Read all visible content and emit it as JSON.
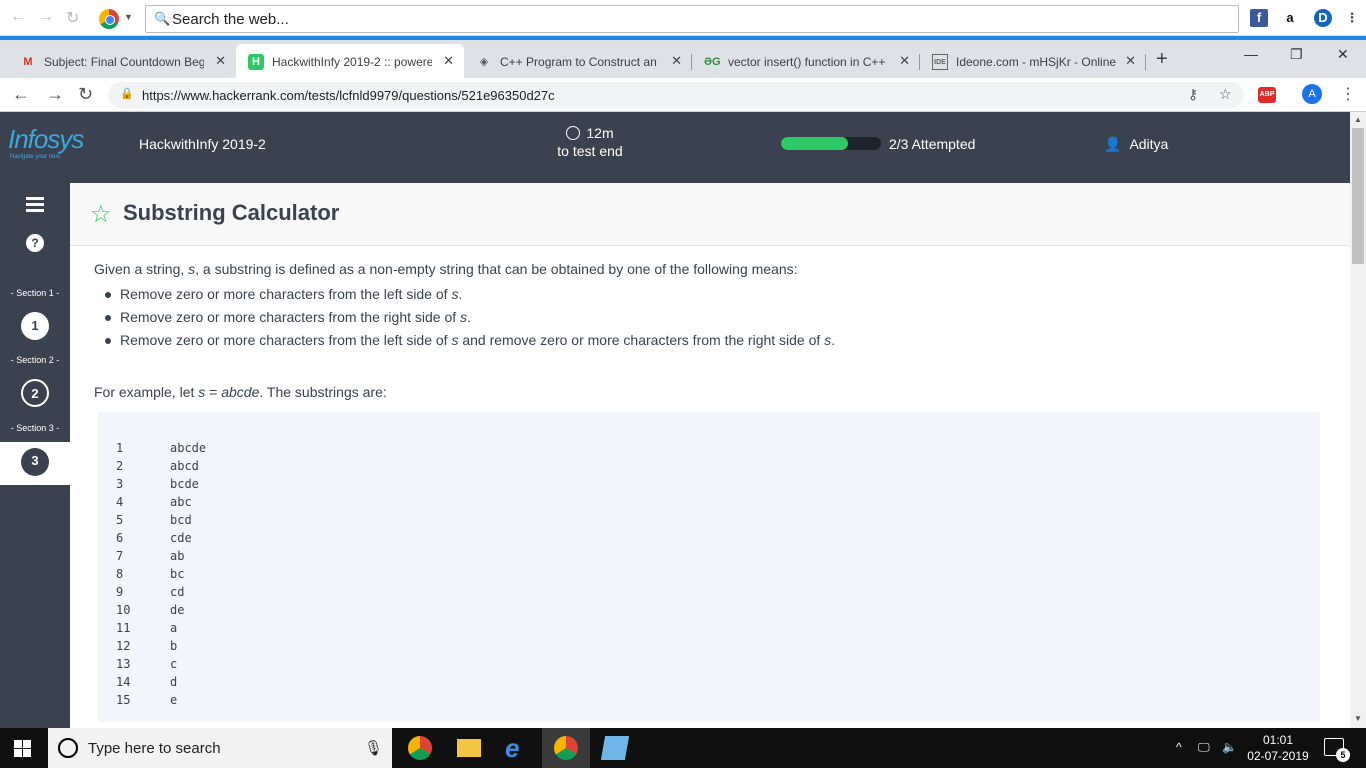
{
  "topbar": {
    "search_text": "Search the web...",
    "ext_amazon": "a",
    "ext_d": "D"
  },
  "tabs": [
    {
      "favicon": "M",
      "favicon_color": "#d93025",
      "title": "Subject: Final Countdown Begi"
    },
    {
      "favicon": "H",
      "favicon_color": "#2ec866",
      "title": "HackwithInfy 2019-2 :: powere"
    },
    {
      "favicon": "◈",
      "favicon_color": "#555555",
      "title": "C++ Program to Construct an"
    },
    {
      "favicon": "ƏG",
      "favicon_color": "#2f8d46",
      "title": "vector insert() function in C++"
    },
    {
      "favicon": "IDE",
      "favicon_color": "#666666",
      "title": "Ideone.com - mHSjKr - Online"
    }
  ],
  "address": {
    "url": "https://www.hackerrank.com/tests/lcfnld9979/questions/521e96350d27c",
    "abp": "ABP",
    "profile": "A"
  },
  "header": {
    "logo": "Infosys",
    "logo_tagline": "Navigate your next",
    "test_title": "HackwithInfy 2019-2",
    "time_value": "12m",
    "time_label": "to test end",
    "progress_fraction": 0.67,
    "attempted": "2/3 Attempted",
    "user": "Aditya"
  },
  "sidebar": {
    "help": "?",
    "sections": [
      {
        "label": "- Section 1 -",
        "question": "1"
      },
      {
        "label": "- Section 2 -",
        "question": "2"
      },
      {
        "label": "- Section 3 -",
        "question": "3"
      }
    ]
  },
  "problem": {
    "title": "Substring Calculator",
    "intro_pre": "Given a string, ",
    "intro_var": "s",
    "intro_post": ", a substring is defined as a non-empty string that can be obtained by one of the following means:",
    "bullets": [
      {
        "pre": "Remove zero or more characters from the left side of ",
        "var": "s",
        "post": "."
      },
      {
        "pre": "Remove zero or more characters from the right side of ",
        "var": "s",
        "post": "."
      },
      {
        "pre": "Remove zero or more characters from the left side of ",
        "var": "s",
        "post": " and remove zero or more characters from the right side of ",
        "var2": "s",
        "post2": "."
      }
    ],
    "example_pre": "For example, let ",
    "example_var": "s",
    "example_eq": " = ",
    "example_val": "abcde",
    "example_post": ". The substrings are:",
    "code_rows": [
      {
        "n": "1",
        "v": "abcde"
      },
      {
        "n": "2",
        "v": "abcd"
      },
      {
        "n": "3",
        "v": "bcde"
      },
      {
        "n": "4",
        "v": "abc"
      },
      {
        "n": "5",
        "v": "bcd"
      },
      {
        "n": "6",
        "v": "cde"
      },
      {
        "n": "7",
        "v": "ab"
      },
      {
        "n": "8",
        "v": "bc"
      },
      {
        "n": "9",
        "v": "cd"
      },
      {
        "n": "10",
        "v": "de"
      },
      {
        "n": "11",
        "v": "a"
      },
      {
        "n": "12",
        "v": "b"
      },
      {
        "n": "13",
        "v": "c"
      },
      {
        "n": "14",
        "v": "d"
      },
      {
        "n": "15",
        "v": "e"
      }
    ]
  },
  "taskbar": {
    "search_placeholder": "Type here to search",
    "time": "01:01",
    "date": "02-07-2019",
    "notifications": "5"
  },
  "colors": {
    "header_bg": "#39424e",
    "accent_green": "#2ec866",
    "chrome_accent": "#1e88e5"
  }
}
